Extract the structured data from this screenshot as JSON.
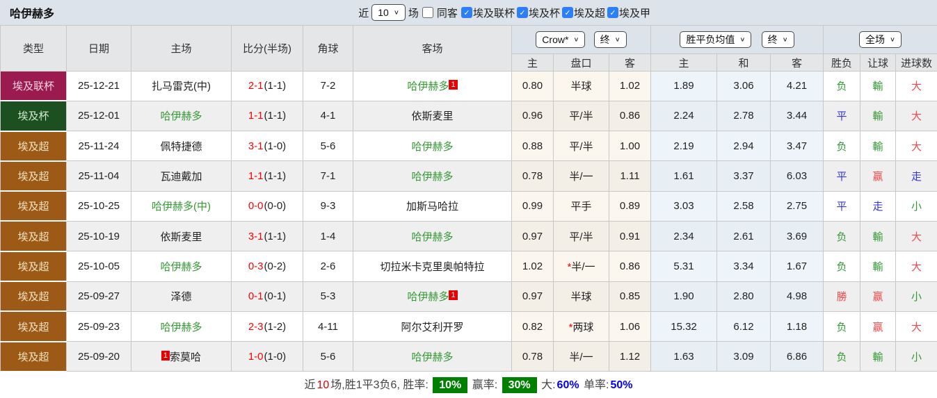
{
  "title": "哈伊赫多",
  "controls": {
    "near_label": "近",
    "matches_value": "10",
    "matches_label": "场",
    "same_away_label": "同客",
    "same_away_checked": false,
    "league_filters": [
      {
        "label": "埃及联杯",
        "checked": true
      },
      {
        "label": "埃及杯",
        "checked": true
      },
      {
        "label": "埃及超",
        "checked": true
      },
      {
        "label": "埃及甲",
        "checked": true
      }
    ]
  },
  "header": {
    "col_type": "类型",
    "col_date": "日期",
    "col_home": "主场",
    "col_score": "比分(半场)",
    "col_corner": "角球",
    "col_away": "客场",
    "odds_source_select": "Crow*",
    "odds_time_select": "终",
    "avg_select": "胜平负均值",
    "avg_time_select": "终",
    "scope_select": "全场",
    "odds_cols": [
      "主",
      "盘口",
      "客"
    ],
    "avg_cols": [
      "主",
      "和",
      "客"
    ],
    "result_cols": [
      "胜负",
      "让球",
      "进球数"
    ]
  },
  "rows": [
    {
      "league": "埃及联杯",
      "date": "25-12-21",
      "home": "扎马雷克(中)",
      "home_green": false,
      "home_badge": "",
      "home_badge_pos": "",
      "away": "哈伊赫多",
      "away_green": true,
      "away_badge": "1",
      "away_badge_pos": "suffix",
      "score": "2-1",
      "half": "(1-1)",
      "corner": "7-2",
      "odds_home": "0.80",
      "handicap": "半球",
      "handicap_star": false,
      "odds_away": "1.02",
      "avg_win": "1.89",
      "avg_draw": "3.06",
      "avg_lose": "4.21",
      "res_wdl": "负",
      "res_wdl_c": "green",
      "res_handicap": "輸",
      "res_handicap_c": "green",
      "res_goals": "大",
      "res_goals_c": "red"
    },
    {
      "league": "埃及杯",
      "date": "25-12-01",
      "home": "哈伊赫多",
      "home_green": true,
      "home_badge": "",
      "home_badge_pos": "",
      "away": "依斯麦里",
      "away_green": false,
      "away_badge": "",
      "away_badge_pos": "",
      "score": "1-1",
      "half": "(1-1)",
      "corner": "4-1",
      "odds_home": "0.96",
      "handicap": "平/半",
      "handicap_star": false,
      "odds_away": "0.86",
      "avg_win": "2.24",
      "avg_draw": "2.78",
      "avg_lose": "3.44",
      "res_wdl": "平",
      "res_wdl_c": "blue",
      "res_handicap": "輸",
      "res_handicap_c": "green",
      "res_goals": "大",
      "res_goals_c": "red"
    },
    {
      "league": "埃及超",
      "date": "25-11-24",
      "home": "佩特捷德",
      "home_green": false,
      "home_badge": "",
      "home_badge_pos": "",
      "away": "哈伊赫多",
      "away_green": true,
      "away_badge": "",
      "away_badge_pos": "",
      "score": "3-1",
      "half": "(1-0)",
      "corner": "5-6",
      "odds_home": "0.88",
      "handicap": "平/半",
      "handicap_star": false,
      "odds_away": "1.00",
      "avg_win": "2.19",
      "avg_draw": "2.94",
      "avg_lose": "3.47",
      "res_wdl": "负",
      "res_wdl_c": "green",
      "res_handicap": "輸",
      "res_handicap_c": "green",
      "res_goals": "大",
      "res_goals_c": "red"
    },
    {
      "league": "埃及超",
      "date": "25-11-04",
      "home": "瓦迪戴加",
      "home_green": false,
      "home_badge": "",
      "home_badge_pos": "",
      "away": "哈伊赫多",
      "away_green": true,
      "away_badge": "",
      "away_badge_pos": "",
      "score": "1-1",
      "half": "(1-1)",
      "corner": "7-1",
      "odds_home": "0.78",
      "handicap": "半/一",
      "handicap_star": false,
      "odds_away": "1.11",
      "avg_win": "1.61",
      "avg_draw": "3.37",
      "avg_lose": "6.03",
      "res_wdl": "平",
      "res_wdl_c": "blue",
      "res_handicap": "赢",
      "res_handicap_c": "red",
      "res_goals": "走",
      "res_goals_c": "blue"
    },
    {
      "league": "埃及超",
      "date": "25-10-25",
      "home": "哈伊赫多(中)",
      "home_green": true,
      "home_badge": "",
      "home_badge_pos": "",
      "away": "加斯马哈拉",
      "away_green": false,
      "away_badge": "",
      "away_badge_pos": "",
      "score": "0-0",
      "half": "(0-0)",
      "corner": "9-3",
      "odds_home": "0.99",
      "handicap": "平手",
      "handicap_star": false,
      "odds_away": "0.89",
      "avg_win": "3.03",
      "avg_draw": "2.58",
      "avg_lose": "2.75",
      "res_wdl": "平",
      "res_wdl_c": "blue",
      "res_handicap": "走",
      "res_handicap_c": "blue",
      "res_goals": "小",
      "res_goals_c": "green"
    },
    {
      "league": "埃及超",
      "date": "25-10-19",
      "home": "依斯麦里",
      "home_green": false,
      "home_badge": "",
      "home_badge_pos": "",
      "away": "哈伊赫多",
      "away_green": true,
      "away_badge": "",
      "away_badge_pos": "",
      "score": "3-1",
      "half": "(1-1)",
      "corner": "1-4",
      "odds_home": "0.97",
      "handicap": "平/半",
      "handicap_star": false,
      "odds_away": "0.91",
      "avg_win": "2.34",
      "avg_draw": "2.61",
      "avg_lose": "3.69",
      "res_wdl": "负",
      "res_wdl_c": "green",
      "res_handicap": "輸",
      "res_handicap_c": "green",
      "res_goals": "大",
      "res_goals_c": "red"
    },
    {
      "league": "埃及超",
      "date": "25-10-05",
      "home": "哈伊赫多",
      "home_green": true,
      "home_badge": "",
      "home_badge_pos": "",
      "away": "切拉米卡克里奥帕特拉",
      "away_green": false,
      "away_badge": "",
      "away_badge_pos": "",
      "score": "0-3",
      "half": "(0-2)",
      "corner": "2-6",
      "odds_home": "1.02",
      "handicap": "半/一",
      "handicap_star": true,
      "odds_away": "0.86",
      "avg_win": "5.31",
      "avg_draw": "3.34",
      "avg_lose": "1.67",
      "res_wdl": "负",
      "res_wdl_c": "green",
      "res_handicap": "輸",
      "res_handicap_c": "green",
      "res_goals": "大",
      "res_goals_c": "red"
    },
    {
      "league": "埃及超",
      "date": "25-09-27",
      "home": "泽德",
      "home_green": false,
      "home_badge": "",
      "home_badge_pos": "",
      "away": "哈伊赫多",
      "away_green": true,
      "away_badge": "1",
      "away_badge_pos": "suffix",
      "score": "0-1",
      "half": "(0-1)",
      "corner": "5-3",
      "odds_home": "0.97",
      "handicap": "半球",
      "handicap_star": false,
      "odds_away": "0.85",
      "avg_win": "1.90",
      "avg_draw": "2.80",
      "avg_lose": "4.98",
      "res_wdl": "勝",
      "res_wdl_c": "red",
      "res_handicap": "赢",
      "res_handicap_c": "red",
      "res_goals": "小",
      "res_goals_c": "green"
    },
    {
      "league": "埃及超",
      "date": "25-09-23",
      "home": "哈伊赫多",
      "home_green": true,
      "home_badge": "",
      "home_badge_pos": "",
      "away": "阿尔艾利开罗",
      "away_green": false,
      "away_badge": "",
      "away_badge_pos": "",
      "score": "2-3",
      "half": "(1-2)",
      "corner": "4-11",
      "odds_home": "0.82",
      "handicap": "两球",
      "handicap_star": true,
      "odds_away": "1.06",
      "avg_win": "15.32",
      "avg_draw": "6.12",
      "avg_lose": "1.18",
      "res_wdl": "负",
      "res_wdl_c": "green",
      "res_handicap": "赢",
      "res_handicap_c": "red",
      "res_goals": "大",
      "res_goals_c": "red"
    },
    {
      "league": "埃及超",
      "date": "25-09-20",
      "home": "索莫哈",
      "home_green": false,
      "home_badge": "1",
      "home_badge_pos": "prefix",
      "away": "哈伊赫多",
      "away_green": true,
      "away_badge": "",
      "away_badge_pos": "",
      "score": "1-0",
      "half": "(1-0)",
      "corner": "5-6",
      "odds_home": "0.78",
      "handicap": "半/一",
      "handicap_star": false,
      "odds_away": "1.12",
      "avg_win": "1.63",
      "avg_draw": "3.09",
      "avg_lose": "6.86",
      "res_wdl": "负",
      "res_wdl_c": "green",
      "res_handicap": "輸",
      "res_handicap_c": "green",
      "res_goals": "小",
      "res_goals_c": "green"
    }
  ],
  "summary": {
    "parts": [
      {
        "text": "近",
        "style": "plain"
      },
      {
        "text": "10",
        "style": "red"
      },
      {
        "text": "场,胜1平3负6, 胜率: ",
        "style": "plain"
      },
      {
        "text": "10%",
        "style": "green-badge"
      },
      {
        "text": " 赢率: ",
        "style": "plain"
      },
      {
        "text": "30%",
        "style": "green-badge"
      },
      {
        "text": " 大:",
        "style": "plain"
      },
      {
        "text": "60%",
        "style": "blue"
      },
      {
        "text": " 单率:",
        "style": "plain"
      },
      {
        "text": "50%",
        "style": "blue"
      }
    ]
  },
  "colors": {
    "checkbox_blue": "#2d7ff9",
    "team_green": "#339933",
    "score_red": "#ff0000",
    "result_green": "#339933",
    "result_blue": "#3434dd",
    "result_red": "#f04a4a",
    "badge_red": "#e60000",
    "summary_badge_green": "#008000",
    "summary_blue": "#0000ee",
    "league_colors": {
      "埃及联杯": {
        "bg": "#9b1b50",
        "fg": "#f6d5e2"
      },
      "埃及杯": {
        "bg": "#1c5020",
        "fg": "#cfe9cf"
      },
      "埃及超": {
        "bg": "#9c5a16",
        "fg": "#f3e3c3"
      }
    }
  }
}
